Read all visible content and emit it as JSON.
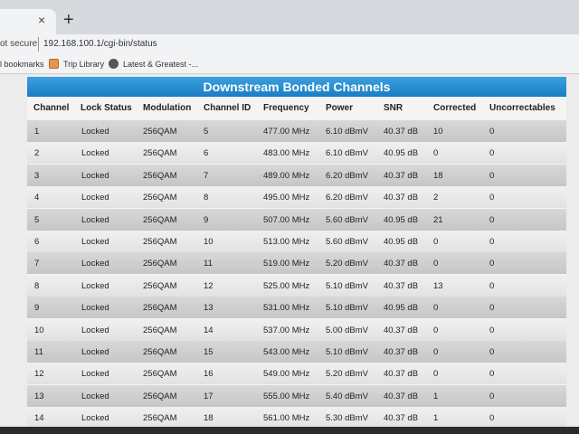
{
  "browser": {
    "new_tab": "+",
    "tab_close": "×",
    "not_secure": "ot secure",
    "url": "192.168.100.1/cgi-bin/status",
    "bookmarks": [
      "l bookmarks",
      "Trip Library",
      "Latest & Greatest -..."
    ]
  },
  "table": {
    "title": "Downstream Bonded Channels",
    "headers": [
      "Channel",
      "Lock Status",
      "Modulation",
      "Channel ID",
      "Frequency",
      "Power",
      "SNR",
      "Corrected",
      "Uncorrectables"
    ],
    "rows": [
      [
        "1",
        "Locked",
        "256QAM",
        "5",
        "477.00 MHz",
        "6.10 dBmV",
        "40.37 dB",
        "10",
        "0"
      ],
      [
        "2",
        "Locked",
        "256QAM",
        "6",
        "483.00 MHz",
        "6.10 dBmV",
        "40.95 dB",
        "0",
        "0"
      ],
      [
        "3",
        "Locked",
        "256QAM",
        "7",
        "489.00 MHz",
        "6.20 dBmV",
        "40.37 dB",
        "18",
        "0"
      ],
      [
        "4",
        "Locked",
        "256QAM",
        "8",
        "495.00 MHz",
        "6.20 dBmV",
        "40.37 dB",
        "2",
        "0"
      ],
      [
        "5",
        "Locked",
        "256QAM",
        "9",
        "507.00 MHz",
        "5.60 dBmV",
        "40.95 dB",
        "21",
        "0"
      ],
      [
        "6",
        "Locked",
        "256QAM",
        "10",
        "513.00 MHz",
        "5.60 dBmV",
        "40.95 dB",
        "0",
        "0"
      ],
      [
        "7",
        "Locked",
        "256QAM",
        "11",
        "519.00 MHz",
        "5.20 dBmV",
        "40.37 dB",
        "0",
        "0"
      ],
      [
        "8",
        "Locked",
        "256QAM",
        "12",
        "525.00 MHz",
        "5.10 dBmV",
        "40.37 dB",
        "13",
        "0"
      ],
      [
        "9",
        "Locked",
        "256QAM",
        "13",
        "531.00 MHz",
        "5.10 dBmV",
        "40.95 dB",
        "0",
        "0"
      ],
      [
        "10",
        "Locked",
        "256QAM",
        "14",
        "537.00 MHz",
        "5.00 dBmV",
        "40.37 dB",
        "0",
        "0"
      ],
      [
        "11",
        "Locked",
        "256QAM",
        "15",
        "543.00 MHz",
        "5.10 dBmV",
        "40.37 dB",
        "0",
        "0"
      ],
      [
        "12",
        "Locked",
        "256QAM",
        "16",
        "549.00 MHz",
        "5.20 dBmV",
        "40.37 dB",
        "0",
        "0"
      ],
      [
        "13",
        "Locked",
        "256QAM",
        "17",
        "555.00 MHz",
        "5.40 dBmV",
        "40.37 dB",
        "1",
        "0"
      ],
      [
        "14",
        "Locked",
        "256QAM",
        "18",
        "561.00 MHz",
        "5.30 dBmV",
        "40.37 dB",
        "1",
        "0"
      ]
    ]
  },
  "colors": {
    "title_bar": "#1b7dc4",
    "row_dark": "#c6c6c6",
    "row_light": "#e2e2e2"
  }
}
